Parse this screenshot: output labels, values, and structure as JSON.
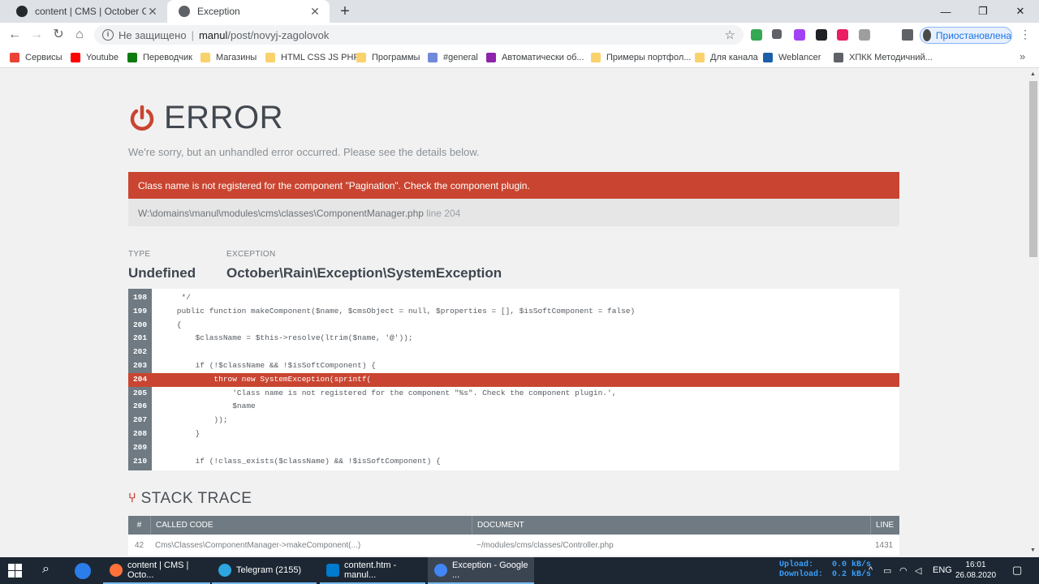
{
  "browser": {
    "tabs": [
      {
        "title": "content | CMS | October CMS"
      },
      {
        "title": "Exception"
      }
    ],
    "address": {
      "security_label": "Не защищено",
      "separator": "|",
      "host": "manul",
      "path": "/post/novyj-zagolovok"
    },
    "profile_label": "Приостановлена",
    "bookmarks": [
      {
        "label": "Сервисы",
        "color": "#ea4335"
      },
      {
        "label": "Youtube",
        "color": "#ff0000"
      },
      {
        "label": "Переводчик",
        "color": "#0f7b0f"
      },
      {
        "label": "Магазины",
        "color": "#f9d26b"
      },
      {
        "label": "HTML CSS JS PHP",
        "color": "#f9d26b"
      },
      {
        "label": "Программы",
        "color": "#f9d26b"
      },
      {
        "label": "#general",
        "color": "#7289da"
      },
      {
        "label": "Автоматически об...",
        "color": "#8e24aa"
      },
      {
        "label": "Примеры портфол...",
        "color": "#f9d26b"
      },
      {
        "label": "Для канала",
        "color": "#f9d26b"
      },
      {
        "label": "Weblancer",
        "color": "#1b5fa8"
      },
      {
        "label": "ХПКК Методичний...",
        "color": "#5f6368"
      }
    ],
    "more_bookmarks": "»"
  },
  "page": {
    "error_title": "ERROR",
    "subtitle": "We're sorry, but an unhandled error occurred. Please see the details below.",
    "message": "Class name is not registered for the component \"Pagination\". Check the component plugin.",
    "file_path": "W:\\domains\\manul\\modules\\cms\\classes\\ComponentManager.php",
    "file_line": "line 204",
    "type_label": "TYPE",
    "type_value": "Undefined",
    "exception_label": "EXCEPTION",
    "exception_value": "October\\Rain\\Exception\\SystemException",
    "accent_color": "#c94531",
    "code_lines": [
      {
        "num": "198",
        "text": "     */"
      },
      {
        "num": "199",
        "text": "    public function makeComponent($name, $cmsObject = null, $properties = [], $isSoftComponent = false)"
      },
      {
        "num": "200",
        "text": "    {"
      },
      {
        "num": "201",
        "text": "        $className = $this->resolve(ltrim($name, '@'));"
      },
      {
        "num": "202",
        "text": ""
      },
      {
        "num": "203",
        "text": "        if (!$className && !$isSoftComponent) {"
      },
      {
        "num": "204",
        "text": "            throw new SystemException(sprintf(",
        "highlight": true
      },
      {
        "num": "205",
        "text": "                'Class name is not registered for the component \"%s\". Check the component plugin.',"
      },
      {
        "num": "206",
        "text": "                $name"
      },
      {
        "num": "207",
        "text": "            ));"
      },
      {
        "num": "208",
        "text": "        }"
      },
      {
        "num": "209",
        "text": ""
      },
      {
        "num": "210",
        "text": "        if (!class_exists($className) && !$isSoftComponent) {"
      }
    ],
    "stack_trace_title": "STACK TRACE",
    "stack_headers": {
      "num": "#",
      "called": "CALLED CODE",
      "document": "DOCUMENT",
      "line": "LINE"
    },
    "stack_rows": [
      {
        "num": "42",
        "called": "Cms\\Classes\\ComponentManager->makeComponent(...)",
        "document": "~/modules/cms/classes/Controller.php",
        "line": "1431"
      }
    ]
  },
  "taskbar": {
    "apps": [
      {
        "label": "content | CMS | Octo...",
        "color": "#ff7139"
      },
      {
        "label": "Telegram (2155)",
        "color": "#2ca5e0"
      },
      {
        "label": "content.htm - manul...",
        "color": "#007acc"
      },
      {
        "label": "Exception - Google ...",
        "color": "#4285f4"
      }
    ],
    "upload_label": "Upload:",
    "upload_value": "0.0 kB/s",
    "download_label": "Download:",
    "download_value": "0.2 kB/s",
    "language": "ENG",
    "time": "16:01",
    "date": "26.08.2020"
  }
}
